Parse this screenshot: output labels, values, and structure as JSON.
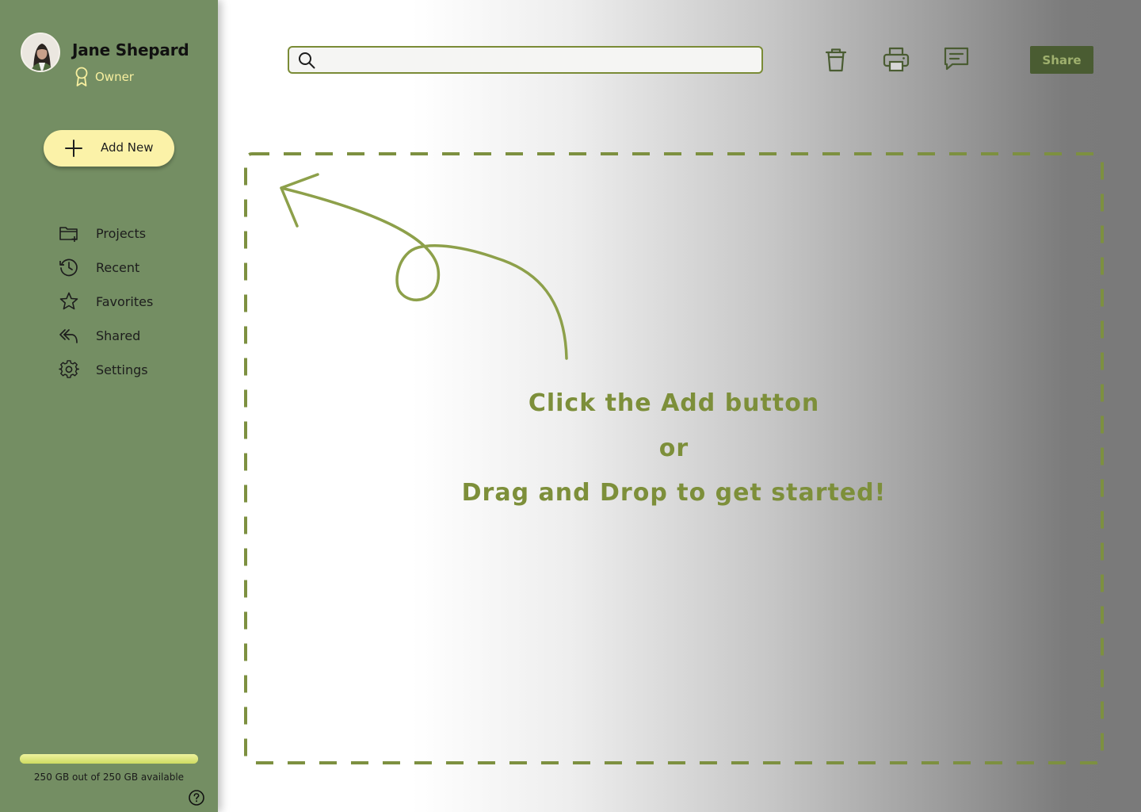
{
  "user": {
    "name": "Jane Shepard",
    "role": "Owner"
  },
  "sidebar": {
    "add_label": "Add New",
    "items": [
      {
        "label": "Projects",
        "icon": "folder-plus-icon"
      },
      {
        "label": "Recent",
        "icon": "history-icon"
      },
      {
        "label": "Favorites",
        "icon": "star-icon"
      },
      {
        "label": "Shared",
        "icon": "reply-all-icon"
      },
      {
        "label": "Settings",
        "icon": "gear-icon"
      }
    ],
    "storage": {
      "text": "250 GB out of 250 GB available",
      "available_fraction": 1.0
    }
  },
  "toolbar": {
    "search_placeholder": "",
    "share_label": "Share",
    "icons": [
      "trash-icon",
      "printer-icon",
      "comment-icon"
    ]
  },
  "dropzone": {
    "line1": "Click the Add button",
    "line2": "or",
    "line3": "Drag and Drop to get started!"
  },
  "colors": {
    "sidebar_bg": "#748e63",
    "accent": "#7d8f3a",
    "button_yellow": "#fbf2a8",
    "share_bg": "#4a5c32",
    "role_text": "#f7ef9f"
  }
}
